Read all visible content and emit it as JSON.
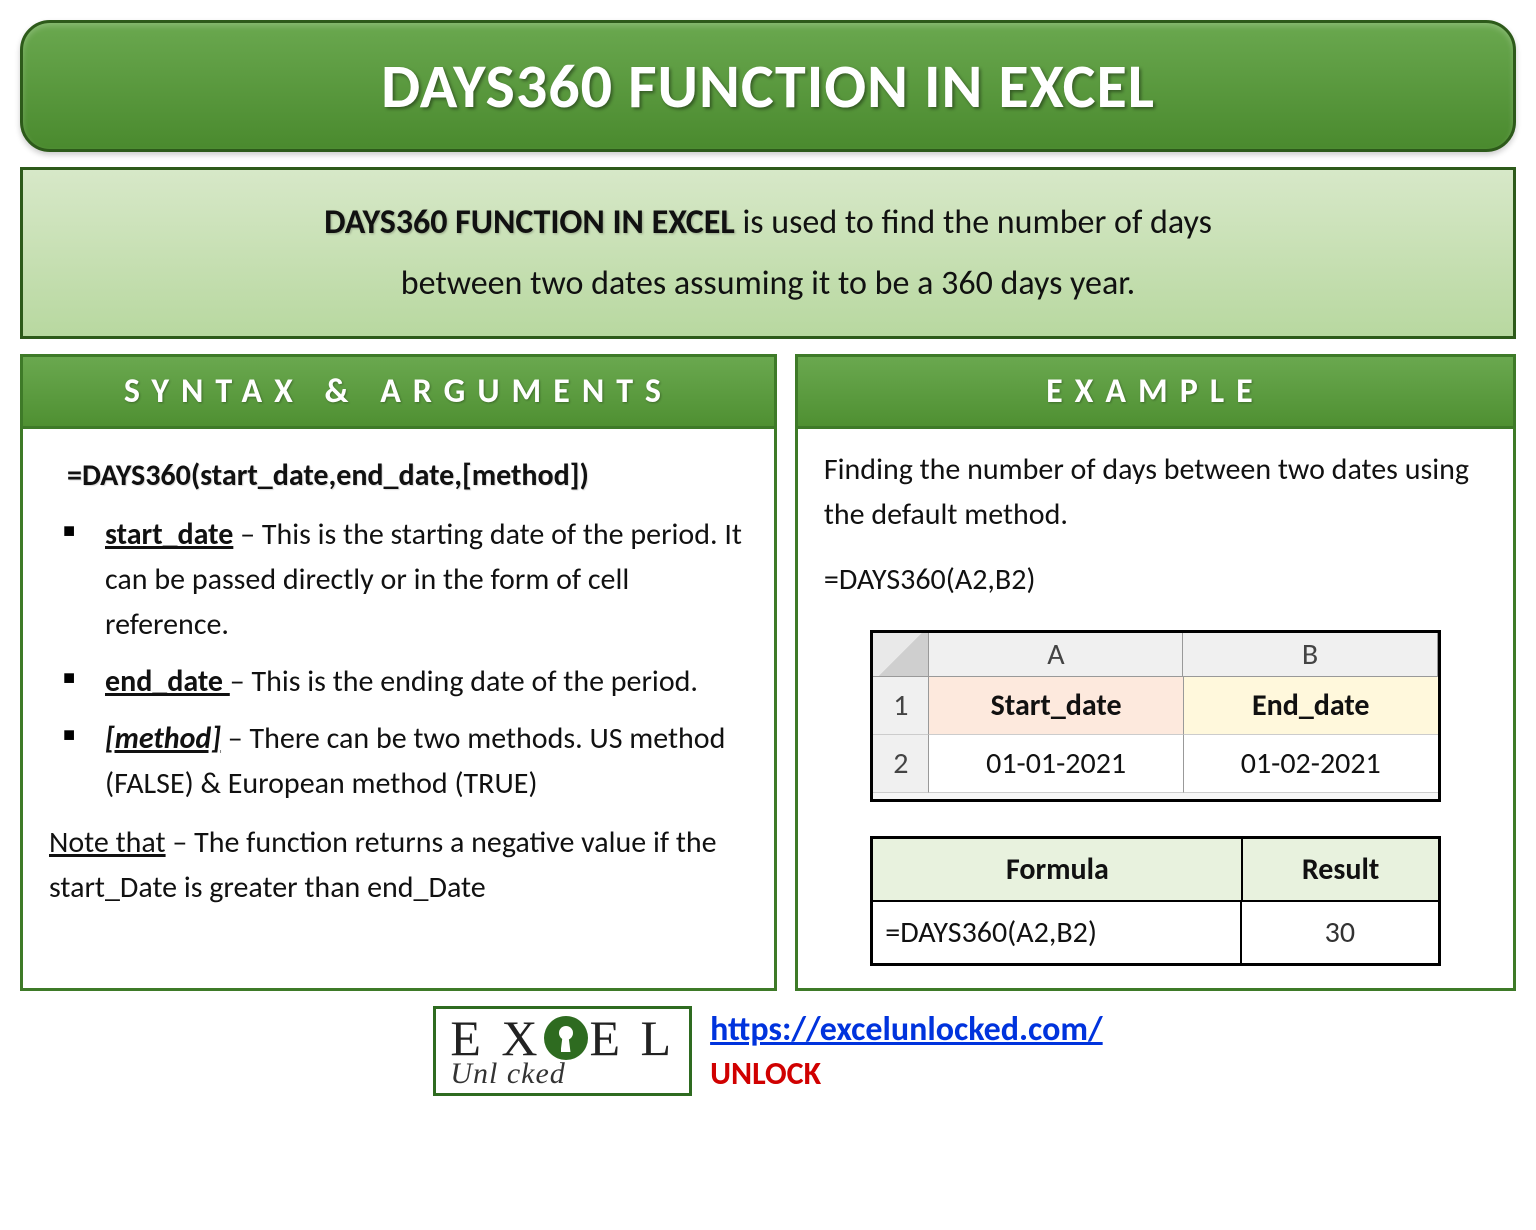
{
  "title": "DAYS360 FUNCTION IN EXCEL",
  "description": {
    "lead": "DAYS360 FUNCTION IN EXCEL",
    "rest1": " is used to find the number of days",
    "rest2": "between two dates assuming it to be a 360 days year."
  },
  "syntax": {
    "header": "SYNTAX & ARGUMENTS",
    "formula": "=DAYS360(start_date,end_date,[method])",
    "args": [
      {
        "name": "start_date",
        "text": " – This is the starting date of the period. It can be passed directly or in the form of cell reference."
      },
      {
        "name": "end_date ",
        "text": "– This is the ending date of the period."
      },
      {
        "name": "[method]",
        "text": " – There can be two methods. US method (FALSE) & European method (TRUE)"
      }
    ],
    "note_label": "Note that",
    "note_text": " – The function returns a negative value if the start_Date is greater than end_Date"
  },
  "example": {
    "header": "EXAMPLE",
    "intro": "Finding the number of days between two dates using the default method.",
    "formula_line": "=DAYS360(A2,B2)",
    "grid": {
      "col_a": "A",
      "col_b": "B",
      "row1": "1",
      "row2": "2",
      "a1": "Start_date",
      "b1": "End_date",
      "a2": "01-01-2021",
      "b2": "01-02-2021"
    },
    "result": {
      "h1": "Formula",
      "h2": "Result",
      "c1": "=DAYS360(A2,B2)",
      "c2": "30"
    }
  },
  "footer": {
    "logo_top_1": "E X ",
    "logo_top_2": " E L",
    "logo_bottom": "Unl   cked",
    "link": "https://excelunlocked.com/",
    "unlock": "UNLOCK"
  }
}
